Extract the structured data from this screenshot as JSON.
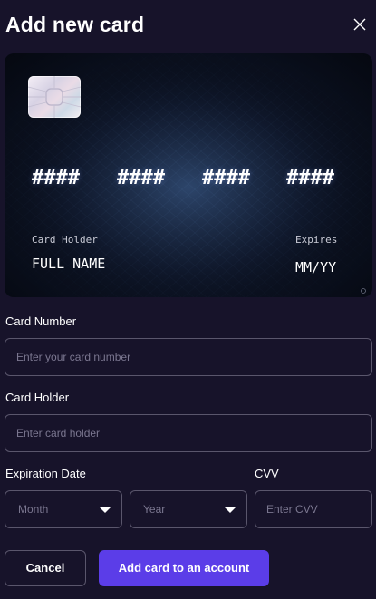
{
  "dialog": {
    "title": "Add new card"
  },
  "icons": {
    "close": "close-icon",
    "chip": "card-chip-icon",
    "caret": "chevron-down-icon"
  },
  "card_preview": {
    "number_groups": [
      "####",
      "####",
      "####",
      "####"
    ],
    "holder_label": "Card Holder",
    "holder_value": "FULL NAME",
    "expires_label": "Expires",
    "expires_value": "MM/YY"
  },
  "form": {
    "card_number": {
      "label": "Card Number",
      "placeholder": "Enter your card number",
      "value": ""
    },
    "card_holder": {
      "label": "Card Holder",
      "placeholder": "Enter card holder",
      "value": ""
    },
    "expiration": {
      "label": "Expiration Date",
      "month_selected": "Month",
      "year_selected": "Year"
    },
    "cvv": {
      "label": "CVV",
      "placeholder": "Enter CVV",
      "value": ""
    }
  },
  "actions": {
    "cancel_label": "Cancel",
    "submit_label": "Add card to an account"
  },
  "colors": {
    "background": "#17132a",
    "accent": "#5b3de8",
    "border": "#5a566c",
    "placeholder": "#7b7790"
  }
}
